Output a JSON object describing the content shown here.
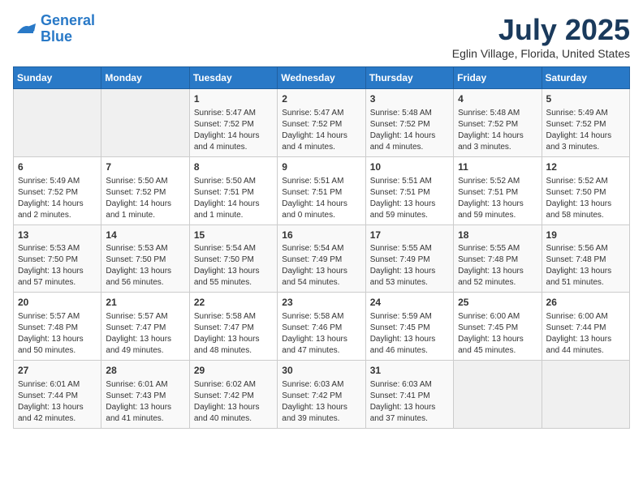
{
  "header": {
    "logo_line1": "General",
    "logo_line2": "Blue",
    "month": "July 2025",
    "location": "Eglin Village, Florida, United States"
  },
  "days_of_week": [
    "Sunday",
    "Monday",
    "Tuesday",
    "Wednesday",
    "Thursday",
    "Friday",
    "Saturday"
  ],
  "weeks": [
    [
      {
        "day": "",
        "info": ""
      },
      {
        "day": "",
        "info": ""
      },
      {
        "day": "1",
        "info": "Sunrise: 5:47 AM\nSunset: 7:52 PM\nDaylight: 14 hours\nand 4 minutes."
      },
      {
        "day": "2",
        "info": "Sunrise: 5:47 AM\nSunset: 7:52 PM\nDaylight: 14 hours\nand 4 minutes."
      },
      {
        "day": "3",
        "info": "Sunrise: 5:48 AM\nSunset: 7:52 PM\nDaylight: 14 hours\nand 4 minutes."
      },
      {
        "day": "4",
        "info": "Sunrise: 5:48 AM\nSunset: 7:52 PM\nDaylight: 14 hours\nand 3 minutes."
      },
      {
        "day": "5",
        "info": "Sunrise: 5:49 AM\nSunset: 7:52 PM\nDaylight: 14 hours\nand 3 minutes."
      }
    ],
    [
      {
        "day": "6",
        "info": "Sunrise: 5:49 AM\nSunset: 7:52 PM\nDaylight: 14 hours\nand 2 minutes."
      },
      {
        "day": "7",
        "info": "Sunrise: 5:50 AM\nSunset: 7:52 PM\nDaylight: 14 hours\nand 1 minute."
      },
      {
        "day": "8",
        "info": "Sunrise: 5:50 AM\nSunset: 7:51 PM\nDaylight: 14 hours\nand 1 minute."
      },
      {
        "day": "9",
        "info": "Sunrise: 5:51 AM\nSunset: 7:51 PM\nDaylight: 14 hours\nand 0 minutes."
      },
      {
        "day": "10",
        "info": "Sunrise: 5:51 AM\nSunset: 7:51 PM\nDaylight: 13 hours\nand 59 minutes."
      },
      {
        "day": "11",
        "info": "Sunrise: 5:52 AM\nSunset: 7:51 PM\nDaylight: 13 hours\nand 59 minutes."
      },
      {
        "day": "12",
        "info": "Sunrise: 5:52 AM\nSunset: 7:50 PM\nDaylight: 13 hours\nand 58 minutes."
      }
    ],
    [
      {
        "day": "13",
        "info": "Sunrise: 5:53 AM\nSunset: 7:50 PM\nDaylight: 13 hours\nand 57 minutes."
      },
      {
        "day": "14",
        "info": "Sunrise: 5:53 AM\nSunset: 7:50 PM\nDaylight: 13 hours\nand 56 minutes."
      },
      {
        "day": "15",
        "info": "Sunrise: 5:54 AM\nSunset: 7:50 PM\nDaylight: 13 hours\nand 55 minutes."
      },
      {
        "day": "16",
        "info": "Sunrise: 5:54 AM\nSunset: 7:49 PM\nDaylight: 13 hours\nand 54 minutes."
      },
      {
        "day": "17",
        "info": "Sunrise: 5:55 AM\nSunset: 7:49 PM\nDaylight: 13 hours\nand 53 minutes."
      },
      {
        "day": "18",
        "info": "Sunrise: 5:55 AM\nSunset: 7:48 PM\nDaylight: 13 hours\nand 52 minutes."
      },
      {
        "day": "19",
        "info": "Sunrise: 5:56 AM\nSunset: 7:48 PM\nDaylight: 13 hours\nand 51 minutes."
      }
    ],
    [
      {
        "day": "20",
        "info": "Sunrise: 5:57 AM\nSunset: 7:48 PM\nDaylight: 13 hours\nand 50 minutes."
      },
      {
        "day": "21",
        "info": "Sunrise: 5:57 AM\nSunset: 7:47 PM\nDaylight: 13 hours\nand 49 minutes."
      },
      {
        "day": "22",
        "info": "Sunrise: 5:58 AM\nSunset: 7:47 PM\nDaylight: 13 hours\nand 48 minutes."
      },
      {
        "day": "23",
        "info": "Sunrise: 5:58 AM\nSunset: 7:46 PM\nDaylight: 13 hours\nand 47 minutes."
      },
      {
        "day": "24",
        "info": "Sunrise: 5:59 AM\nSunset: 7:45 PM\nDaylight: 13 hours\nand 46 minutes."
      },
      {
        "day": "25",
        "info": "Sunrise: 6:00 AM\nSunset: 7:45 PM\nDaylight: 13 hours\nand 45 minutes."
      },
      {
        "day": "26",
        "info": "Sunrise: 6:00 AM\nSunset: 7:44 PM\nDaylight: 13 hours\nand 44 minutes."
      }
    ],
    [
      {
        "day": "27",
        "info": "Sunrise: 6:01 AM\nSunset: 7:44 PM\nDaylight: 13 hours\nand 42 minutes."
      },
      {
        "day": "28",
        "info": "Sunrise: 6:01 AM\nSunset: 7:43 PM\nDaylight: 13 hours\nand 41 minutes."
      },
      {
        "day": "29",
        "info": "Sunrise: 6:02 AM\nSunset: 7:42 PM\nDaylight: 13 hours\nand 40 minutes."
      },
      {
        "day": "30",
        "info": "Sunrise: 6:03 AM\nSunset: 7:42 PM\nDaylight: 13 hours\nand 39 minutes."
      },
      {
        "day": "31",
        "info": "Sunrise: 6:03 AM\nSunset: 7:41 PM\nDaylight: 13 hours\nand 37 minutes."
      },
      {
        "day": "",
        "info": ""
      },
      {
        "day": "",
        "info": ""
      }
    ]
  ]
}
